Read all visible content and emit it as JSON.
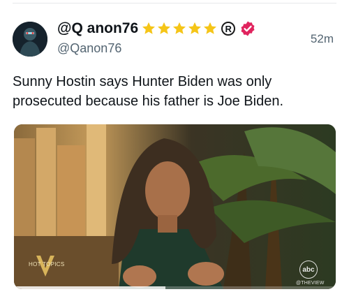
{
  "tweet": {
    "display_name": "@Q anon76",
    "handle": "@Qanon76",
    "time": "52m",
    "star_count": 5,
    "star_color": "#f5c518",
    "verified_color": "#e0245e",
    "icons": [
      "star-icon",
      "registered-icon",
      "verified-badge-icon"
    ],
    "text": "Sunny Hostin says Hunter Biden was only prosecuted because his father is Joe Biden."
  },
  "media": {
    "overlay_left_text": "HOT TOPICS",
    "network_logo_text": "abc",
    "network_label": "@THEVIEW",
    "progress": 0.47
  }
}
